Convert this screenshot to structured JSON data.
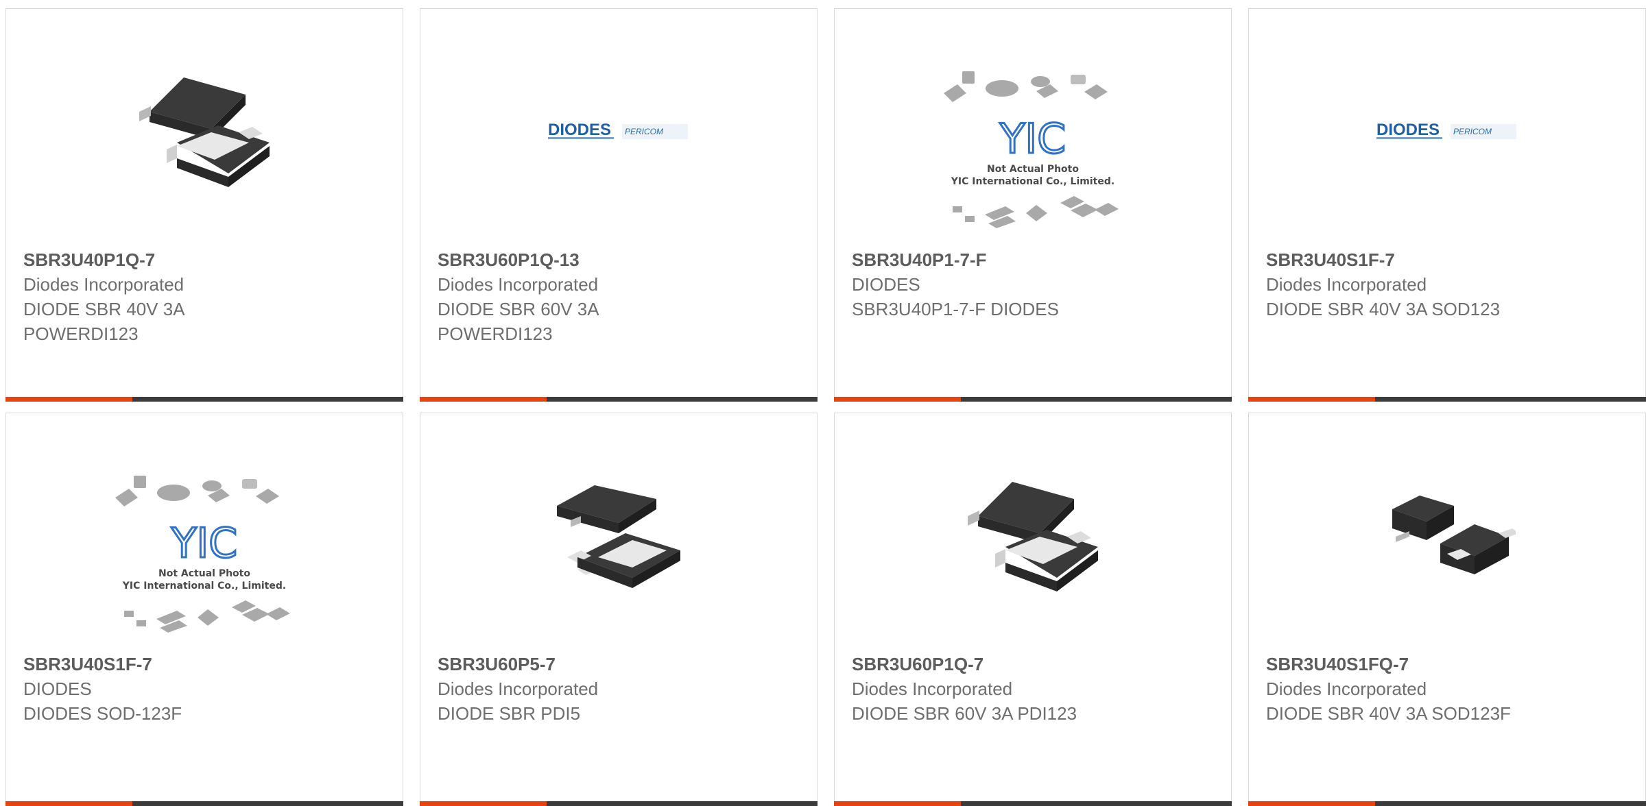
{
  "colors": {
    "accent": "#e8420e",
    "bar": "#3b3b3b",
    "text": "#6e6e6e"
  },
  "products": [
    {
      "image": "diode-package-photo",
      "part_number": "SBR3U40P1Q-7",
      "lines": [
        "Diodes Incorporated",
        "DIODE SBR 40V 3A",
        "POWERDI123"
      ]
    },
    {
      "image": "diodes-pericom-logo",
      "logo": {
        "brand": "DIODES",
        "sub": "PERICOM"
      },
      "part_number": "SBR3U60P1Q-13",
      "lines": [
        "Diodes Incorporated",
        "DIODE SBR 60V 3A",
        "POWERDI123"
      ]
    },
    {
      "image": "yic-placeholder",
      "placeholder": {
        "brand": "YIC",
        "caption1": "Not Actual Photo",
        "caption2": "YIC International Co., Limited."
      },
      "part_number": "SBR3U40P1-7-F",
      "lines": [
        "DIODES",
        "SBR3U40P1-7-F DIODES"
      ]
    },
    {
      "image": "diodes-pericom-logo",
      "logo": {
        "brand": "DIODES",
        "sub": "PERICOM"
      },
      "part_number": "SBR3U40S1F-7",
      "lines": [
        "Diodes Incorporated",
        "DIODE SBR 40V 3A SOD123"
      ]
    },
    {
      "image": "yic-placeholder",
      "placeholder": {
        "brand": "YIC",
        "caption1": "Not Actual Photo",
        "caption2": "YIC International Co., Limited."
      },
      "part_number": "SBR3U40S1F-7",
      "lines": [
        "DIODES",
        "DIODES SOD-123F"
      ]
    },
    {
      "image": "pdi5-package-photo",
      "part_number": "SBR3U60P5-7",
      "lines": [
        "Diodes Incorporated",
        "DIODE SBR PDI5"
      ]
    },
    {
      "image": "diode-package-photo",
      "part_number": "SBR3U60P1Q-7",
      "lines": [
        "Diodes Incorporated",
        "DIODE SBR 60V 3A PDI123"
      ]
    },
    {
      "image": "sod123f-package-photo",
      "part_number": "SBR3U40S1FQ-7",
      "lines": [
        "Diodes Incorporated",
        "DIODE SBR 40V 3A SOD123F"
      ]
    }
  ]
}
